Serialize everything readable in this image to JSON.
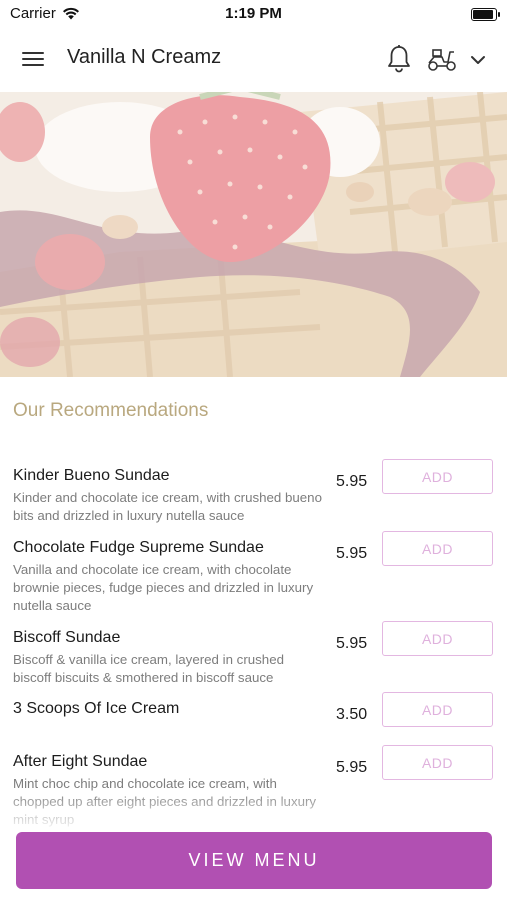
{
  "status_bar": {
    "carrier": "Carrier",
    "time": "1:19 PM",
    "battery_level": 1.0
  },
  "header": {
    "title": "Vanilla N Creamz"
  },
  "section": {
    "title": "Our Recommendations"
  },
  "items": [
    {
      "name": "Kinder Bueno Sundae",
      "description": "Kinder and chocolate ice cream, with crushed bueno bits and drizzled in luxury nutella sauce",
      "price": "5.95",
      "add_label": "ADD"
    },
    {
      "name": "Chocolate Fudge Supreme Sundae",
      "description": "Vanilla and chocolate ice cream, with chocolate brownie pieces, fudge pieces and drizzled in luxury nutella sauce",
      "price": "5.95",
      "add_label": "ADD"
    },
    {
      "name": "Biscoff Sundae",
      "description": "Biscoff & vanilla ice cream, layered in crushed biscoff biscuits & smothered in biscoff sauce",
      "price": "5.95",
      "add_label": "ADD"
    },
    {
      "name": "3 Scoops Of Ice Cream",
      "description": "",
      "price": "3.50",
      "add_label": "ADD"
    },
    {
      "name": "After Eight Sundae",
      "description": "Mint choc chip and chocolate ice cream, with chopped up after eight pieces and drizzled in luxury mint syrup",
      "price": "5.95",
      "add_label": "ADD"
    }
  ],
  "footer": {
    "view_menu_label": "VIEW MENU"
  },
  "colors": {
    "accent": "#b150b2",
    "add_border": "#e3b7e1",
    "section_title": "#b9a87f"
  }
}
